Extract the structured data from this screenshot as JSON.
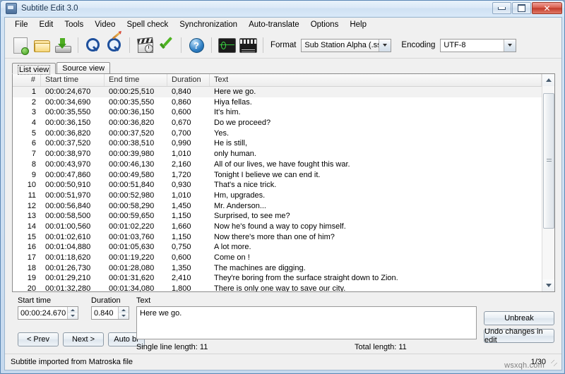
{
  "window": {
    "title": "Subtitle Edit 3.0",
    "app_icon": "subtitle-edit-icon",
    "minimize_label": "",
    "maximize_label": "",
    "close_label": "✕"
  },
  "menu": {
    "items": [
      {
        "label": "File"
      },
      {
        "label": "Edit"
      },
      {
        "label": "Tools"
      },
      {
        "label": "Video"
      },
      {
        "label": "Spell check"
      },
      {
        "label": "Synchronization"
      },
      {
        "label": "Auto-translate"
      },
      {
        "label": "Options"
      },
      {
        "label": "Help"
      }
    ]
  },
  "toolbar": {
    "icons": [
      {
        "name": "new-file-icon"
      },
      {
        "name": "open-folder-icon"
      },
      {
        "name": "save-icon"
      },
      {
        "name": "find-icon"
      },
      {
        "name": "replace-icon"
      },
      {
        "name": "sync-clapper-icon"
      },
      {
        "name": "spell-check-icon"
      },
      {
        "name": "help-icon"
      },
      {
        "name": "waveform-icon"
      },
      {
        "name": "video-icon"
      }
    ],
    "format_label": "Format",
    "format_value": "Sub Station Alpha (.ssa)",
    "encoding_label": "Encoding",
    "encoding_value": "UTF-8"
  },
  "tabs": [
    {
      "label": "List view",
      "active": true
    },
    {
      "label": "Source view",
      "active": false
    }
  ],
  "grid": {
    "columns": [
      "#",
      "Start time",
      "End time",
      "Duration",
      "Text"
    ],
    "rows": [
      {
        "num": "1",
        "start": "00:00:24,670",
        "end": "00:00:25,510",
        "dur": "0,840",
        "text": "Here we go.",
        "selected": true
      },
      {
        "num": "2",
        "start": "00:00:34,690",
        "end": "00:00:35,550",
        "dur": "0,860",
        "text": "Hiya fellas.",
        "selected": false
      },
      {
        "num": "3",
        "start": "00:00:35,550",
        "end": "00:00:36,150",
        "dur": "0,600",
        "text": "It's him.",
        "selected": false
      },
      {
        "num": "4",
        "start": "00:00:36,150",
        "end": "00:00:36,820",
        "dur": "0,670",
        "text": "Do we proceed?",
        "selected": false
      },
      {
        "num": "5",
        "start": "00:00:36,820",
        "end": "00:00:37,520",
        "dur": "0,700",
        "text": "Yes.",
        "selected": false
      },
      {
        "num": "6",
        "start": "00:00:37,520",
        "end": "00:00:38,510",
        "dur": "0,990",
        "text": "He is still,",
        "selected": false
      },
      {
        "num": "7",
        "start": "00:00:38,970",
        "end": "00:00:39,980",
        "dur": "1,010",
        "text": "only human.",
        "selected": false
      },
      {
        "num": "8",
        "start": "00:00:43,970",
        "end": "00:00:46,130",
        "dur": "2,160",
        "text": "All of our lives, we have fought this war.",
        "selected": false
      },
      {
        "num": "9",
        "start": "00:00:47,860",
        "end": "00:00:49,580",
        "dur": "1,720",
        "text": "Tonight I believe we can end it.",
        "selected": false
      },
      {
        "num": "10",
        "start": "00:00:50,910",
        "end": "00:00:51,840",
        "dur": "0,930",
        "text": "That's a nice trick.",
        "selected": false
      },
      {
        "num": "11",
        "start": "00:00:51,970",
        "end": "00:00:52,980",
        "dur": "1,010",
        "text": "Hm, upgrades.",
        "selected": false
      },
      {
        "num": "12",
        "start": "00:00:56,840",
        "end": "00:00:58,290",
        "dur": "1,450",
        "text": "Mr. Anderson...",
        "selected": false
      },
      {
        "num": "13",
        "start": "00:00:58,500",
        "end": "00:00:59,650",
        "dur": "1,150",
        "text": "Surprised, to see me?",
        "selected": false
      },
      {
        "num": "14",
        "start": "00:01:00,560",
        "end": "00:01:02,220",
        "dur": "1,660",
        "text": "Now he's found a way to copy himself.",
        "selected": false
      },
      {
        "num": "15",
        "start": "00:01:02,610",
        "end": "00:01:03,760",
        "dur": "1,150",
        "text": "Now there's more than one of him?",
        "selected": false
      },
      {
        "num": "16",
        "start": "00:01:04,880",
        "end": "00:01:05,630",
        "dur": "0,750",
        "text": "A lot more.",
        "selected": false
      },
      {
        "num": "17",
        "start": "00:01:18,620",
        "end": "00:01:19,220",
        "dur": "0,600",
        "text": "Come on !",
        "selected": false
      },
      {
        "num": "18",
        "start": "00:01:26,730",
        "end": "00:01:28,080",
        "dur": "1,350",
        "text": "The machines are digging.",
        "selected": false
      },
      {
        "num": "19",
        "start": "00:01:29,210",
        "end": "00:01:31,620",
        "dur": "2,410",
        "text": "They're boring from the surface straight down to Zion.",
        "selected": false
      },
      {
        "num": "20",
        "start": "00:01:32,280",
        "end": "00:01:34,080",
        "dur": "1,800",
        "text": "There is only one way to save our city.",
        "selected": false
      }
    ]
  },
  "editor": {
    "start_time_label": "Start time",
    "start_time_value": "00:00:24.670",
    "duration_label": "Duration",
    "duration_value": "0.840",
    "text_label": "Text",
    "text_value": "Here we go.",
    "prev_label": "< Prev",
    "next_label": "Next >",
    "auto_br_label": "Auto br",
    "unbreak_label": "Unbreak",
    "undo_label": "Undo changes in edit",
    "single_line_length": "Single line length: 11",
    "total_length": "Total length: 11"
  },
  "statusbar": {
    "message": "Subtitle imported from Matroska file",
    "counter": "1/30",
    "watermark": "wsxqh.com"
  }
}
